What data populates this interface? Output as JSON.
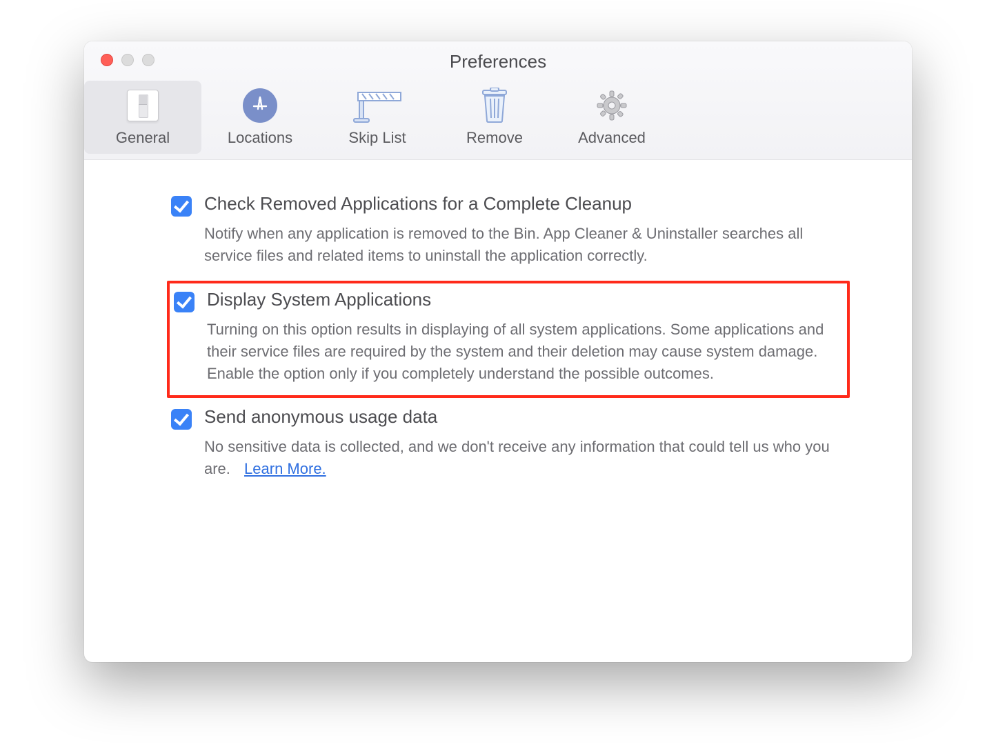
{
  "window": {
    "title": "Preferences"
  },
  "toolbar": {
    "items": [
      {
        "label": "General",
        "selected": true
      },
      {
        "label": "Locations",
        "selected": false
      },
      {
        "label": "Skip List",
        "selected": false
      },
      {
        "label": "Remove",
        "selected": false
      },
      {
        "label": "Advanced",
        "selected": false
      }
    ]
  },
  "options": {
    "cleanup": {
      "checked": true,
      "title": "Check Removed Applications for a Complete Cleanup",
      "description": "Notify when any application is removed to the Bin. App Cleaner & Uninstaller searches all service files and related items to uninstall the application correctly."
    },
    "display_system": {
      "checked": true,
      "title": "Display System Applications",
      "description": "Turning on this option results in displaying of all system applications. Some applications and their service files are required by the system and their deletion may cause system damage. Enable the option only if you completely understand the possible outcomes."
    },
    "anon_usage": {
      "checked": true,
      "title": "Send anonymous usage data",
      "description": "No sensitive data is collected, and we don't receive any information that could tell us who you are.",
      "learn_more": "Learn More."
    }
  },
  "highlight_box": "display_system"
}
